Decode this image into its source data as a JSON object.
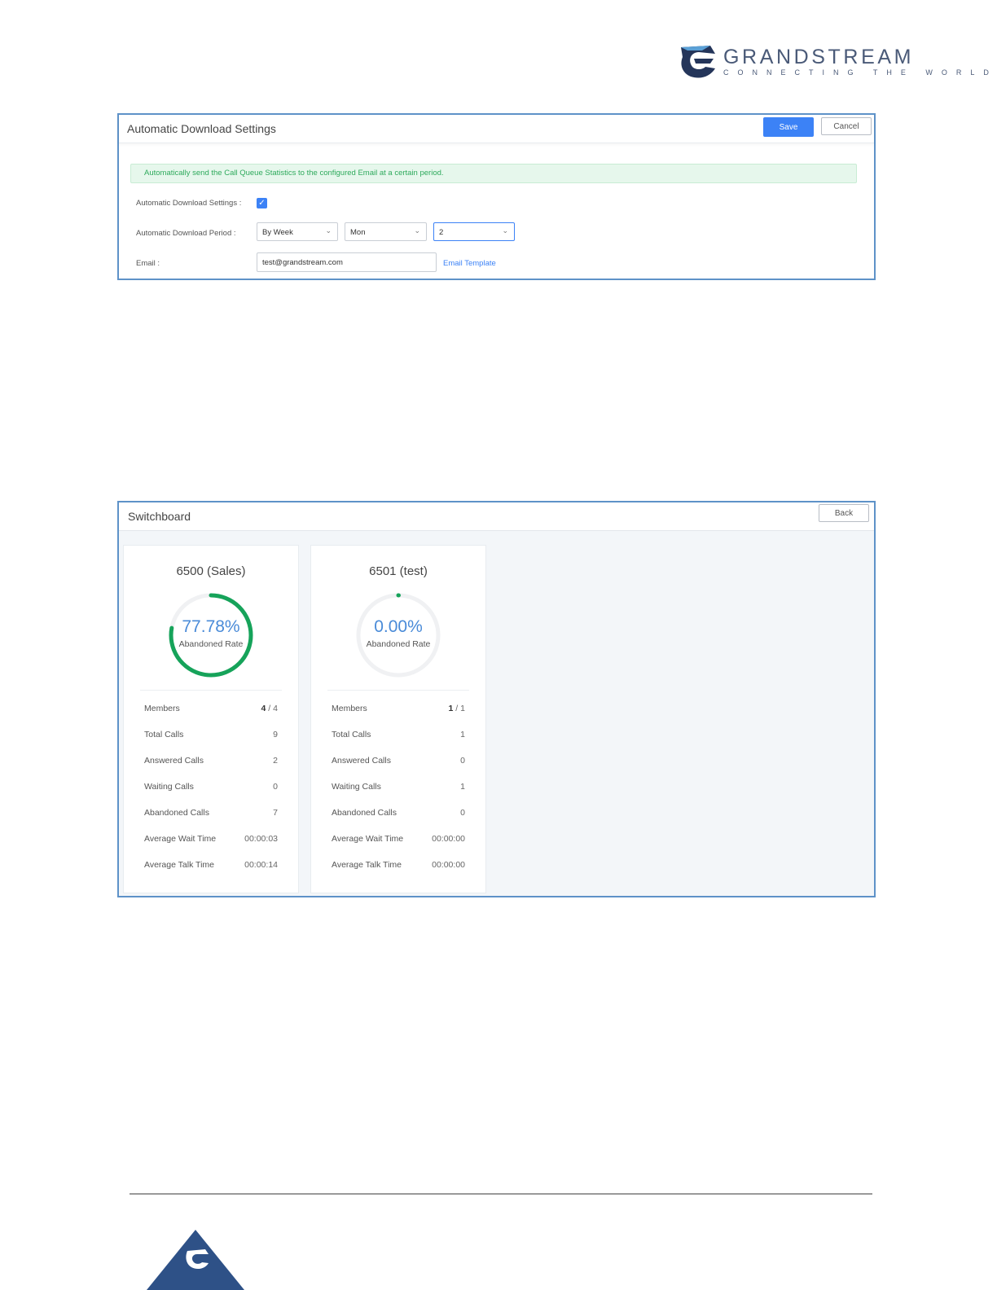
{
  "brand": {
    "name": "GRANDSTREAM",
    "tagline": "CONNECTING THE WORLD",
    "colors": {
      "primary": "#4a5a78",
      "accent": "#3c82f6",
      "success": "#1aa35a"
    }
  },
  "download_settings": {
    "title": "Automatic Download Settings",
    "save_label": "Save",
    "cancel_label": "Cancel",
    "notice": "Automatically send the Call Queue Statistics to the configured Email at a certain period.",
    "enable_label": "Automatic Download Settings :",
    "enable_checked": true,
    "period_label": "Automatic Download Period :",
    "period_type": "By Week",
    "period_day": "Mon",
    "period_hour": "2",
    "email_label": "Email :",
    "email_value": "test@grandstream.com",
    "email_template_link": "Email Template"
  },
  "switchboard": {
    "title": "Switchboard",
    "back_label": "Back",
    "rate_label": "Abandoned Rate",
    "queues": [
      {
        "name": "6500 (Sales)",
        "abandoned_rate": "77.78%",
        "abandoned_fraction": 0.7778,
        "members_online": "4",
        "members_total": "4",
        "stats": [
          {
            "label": "Members",
            "value": ""
          },
          {
            "label": "Total Calls",
            "value": "9"
          },
          {
            "label": "Answered Calls",
            "value": "2"
          },
          {
            "label": "Waiting Calls",
            "value": "0"
          },
          {
            "label": "Abandoned Calls",
            "value": "7"
          },
          {
            "label": "Average Wait Time",
            "value": "00:00:03"
          },
          {
            "label": "Average Talk Time",
            "value": "00:00:14"
          }
        ]
      },
      {
        "name": "6501 (test)",
        "abandoned_rate": "0.00%",
        "abandoned_fraction": 0.0,
        "members_online": "1",
        "members_total": "1",
        "stats": [
          {
            "label": "Members",
            "value": ""
          },
          {
            "label": "Total Calls",
            "value": "1"
          },
          {
            "label": "Answered Calls",
            "value": "0"
          },
          {
            "label": "Waiting Calls",
            "value": "1"
          },
          {
            "label": "Abandoned Calls",
            "value": "0"
          },
          {
            "label": "Average Wait Time",
            "value": "00:00:00"
          },
          {
            "label": "Average Talk Time",
            "value": "00:00:00"
          }
        ]
      }
    ]
  }
}
